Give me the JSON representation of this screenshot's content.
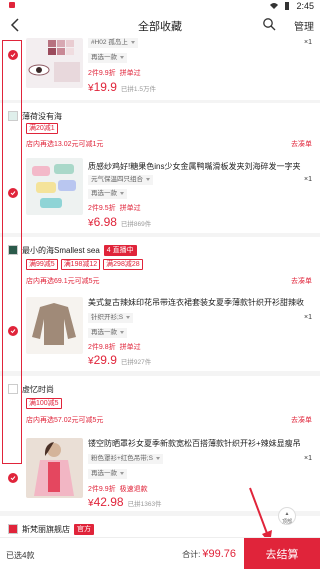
{
  "status": {
    "time": "2:45"
  },
  "nav": {
    "title": "全部收藏",
    "manage": "管理"
  },
  "accent": "#e0243a",
  "items": [
    {
      "sku": "#H02 孤岛上",
      "qty": "×1",
      "alt": "再选一款",
      "deal": "2件9.9折",
      "deal_label": "拼单过",
      "price_symbol": "¥",
      "price": "19.9",
      "sold": "已拼1.5万件"
    }
  ],
  "shops": [
    {
      "name": "薄荷没有海",
      "tags": [
        "满20减1"
      ],
      "promo": "店内再选13.02元可减1元",
      "action": "去凑单",
      "item": {
        "title": "质感纱鸡好!糖果色ins少女金属鸭嘴滑板发夹刘海碎发一字夹",
        "sku": "元气保温四只组合",
        "qty": "×1",
        "alt": "再选一款",
        "deal": "2件9.5折",
        "deal_label": "拼单过",
        "price": "6.98",
        "sold": "已拼869件"
      }
    },
    {
      "name": "最小的海Smallest sea",
      "badge": "4 直播中",
      "tags": [
        "满99减5",
        "满198减12",
        "满298减28"
      ],
      "promo": "店内再选69.1元可减5元",
      "action": "去凑单",
      "item": {
        "title": "美式复古辣妹印花吊带连衣裙套装女夏季薄款针织开衫甜辣收",
        "sku": "针织开衫;S",
        "qty": "×1",
        "alt": "再选一款",
        "deal": "2件9.8折",
        "deal_label": "拼单过",
        "price": "29.9",
        "sold": "已拼927件"
      }
    },
    {
      "name": "虚忆时尚",
      "tags": [
        "满100减5"
      ],
      "promo": "店内再选57.02元可减5元",
      "action": "去凑单",
      "item": {
        "title": "镂空防晒罩衫女夏季新款宽松百搭薄款针织开衫+辣妹显瘦吊",
        "sku": "粉色罩衫+红色吊带;S",
        "qty": "×1",
        "alt": "再选一款",
        "deal": "2件9.9折",
        "deal_label": "极速退款",
        "price": "42.98",
        "sold": "已拼1363件"
      }
    },
    {
      "name": "斯梵丽旗舰店",
      "badge": "官方"
    }
  ],
  "scroll_top": "顶部",
  "bottom": {
    "selected": "已选4款",
    "total_label": "合计:",
    "total": "¥99.76",
    "checkout": "去结算"
  }
}
